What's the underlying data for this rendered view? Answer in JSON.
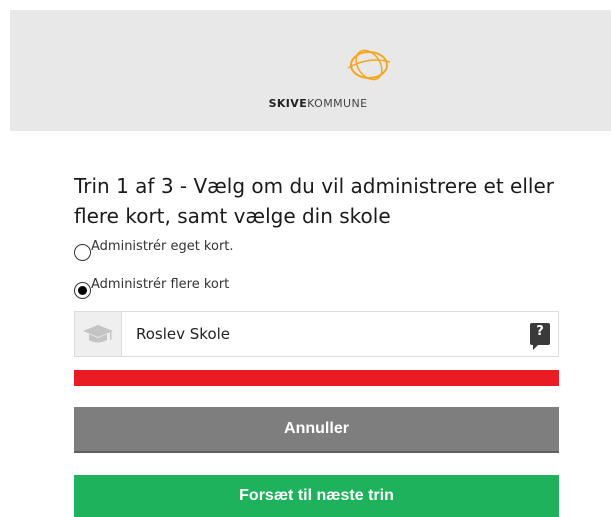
{
  "header": {
    "logo_icon": "skive-orbit-logo-icon",
    "logo_text_bold": "SKIVE",
    "logo_text_light": "KOMMUNE",
    "accent_color": "#f5a623"
  },
  "title": "Trin 1 af 3 - Vælg om du vil administrere et eller flere kort, samt vælge din skole",
  "options": [
    {
      "label": "Administrér eget kort.",
      "checked": false
    },
    {
      "label": "Administrér flere kort",
      "checked": true
    }
  ],
  "school": {
    "icon": "graduation-cap-icon",
    "value": "Roslev Skole",
    "help_icon": "question-icon",
    "help_label": "?"
  },
  "error_bar_color": "#e91c24",
  "buttons": {
    "cancel_label": "Annuller",
    "next_label": "Forsæt til næste trin",
    "cancel_color": "#7e7e7e",
    "next_color": "#1fb25c"
  }
}
